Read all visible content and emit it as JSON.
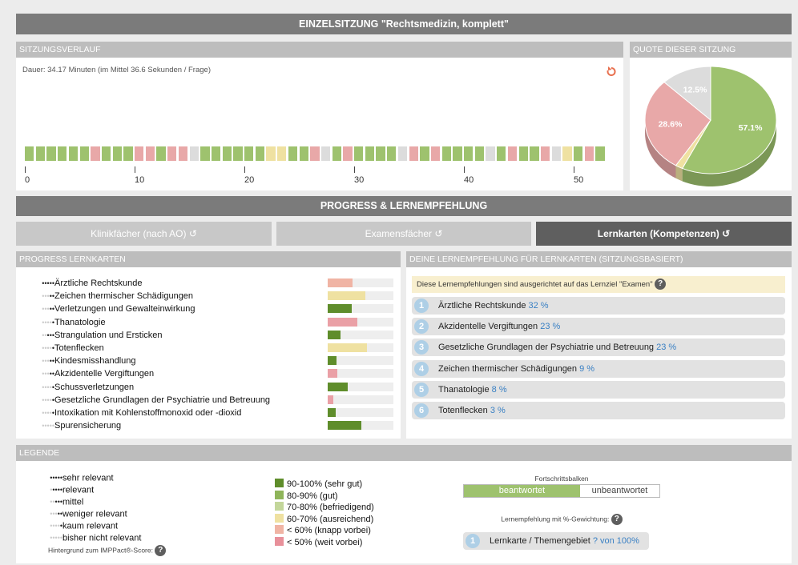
{
  "header": {
    "title": "EINZELSITZUNG \"Rechtsmedizin, komplett\""
  },
  "session": {
    "title": "SITZUNGSVERLAUF",
    "duration": "Dauer: 34.17 Minuten (im Mittel 36.6 Sekunden / Frage)",
    "ticks": [
      "0",
      "10",
      "20",
      "30",
      "40",
      "50"
    ],
    "segments": [
      "g",
      "g",
      "g",
      "g",
      "g",
      "g",
      "r",
      "g",
      "g",
      "g",
      "r",
      "r",
      "g",
      "r",
      "r",
      "x",
      "g",
      "g",
      "g",
      "g",
      "g",
      "g",
      "y",
      "y",
      "g",
      "g",
      "r",
      "x",
      "g",
      "r",
      "g",
      "g",
      "g",
      "g",
      "x",
      "r",
      "g",
      "r",
      "g",
      "g",
      "g",
      "g",
      "x",
      "g",
      "r",
      "g",
      "g",
      "r",
      "x",
      "y",
      "g",
      "r",
      "g"
    ],
    "colors": {
      "g": "#9ec26e",
      "r": "#e8a8a8",
      "y": "#efe1a1",
      "x": "#dcdcdc"
    }
  },
  "quota": {
    "title": "QUOTE DIESER SITZUNG",
    "slices": [
      {
        "label": "57.1%",
        "value": 57.1,
        "color": "#9ec26e"
      },
      {
        "label": "",
        "value": 1.8,
        "color": "#efe1a1"
      },
      {
        "label": "28.6%",
        "value": 28.6,
        "color": "#e8a8a8"
      },
      {
        "label": "12.5%",
        "value": 12.5,
        "color": "#dcdcdc"
      }
    ]
  },
  "progress": {
    "title": "PROGRESS & LERNEMPFEHLUNG"
  },
  "tabs": [
    {
      "label": "Klinikfächer (nach AO) ↺"
    },
    {
      "label": "Examensfächer ↺"
    },
    {
      "label": "Lernkarten (Kompetenzen) ↺"
    }
  ],
  "lernkarten": {
    "title": "PROGRESS LERNKARTEN",
    "items": [
      {
        "label": "Ärztliche Rechtskunde",
        "relevance": 5,
        "progress": 0.38,
        "color": "#f0b4a4"
      },
      {
        "label": "Zeichen thermischer Schädigungen",
        "relevance": 2,
        "progress": 0.57,
        "color": "#efe1a1"
      },
      {
        "label": "Verletzungen und Gewalteinwirkung",
        "relevance": 2,
        "progress": 0.36,
        "color": "#5f8d2b"
      },
      {
        "label": "Thanatologie",
        "relevance": 1,
        "progress": 0.45,
        "color": "#eaa0a6"
      },
      {
        "label": "Strangulation und Ersticken",
        "relevance": 3,
        "progress": 0.2,
        "color": "#5f8d2b"
      },
      {
        "label": "Totenflecken",
        "relevance": 1,
        "progress": 0.6,
        "color": "#efe1a1"
      },
      {
        "label": "Kindesmisshandlung",
        "relevance": 2,
        "progress": 0.14,
        "color": "#5f8d2b"
      },
      {
        "label": "Akzidentelle Vergiftungen",
        "relevance": 2,
        "progress": 0.15,
        "color": "#eaa0a6"
      },
      {
        "label": "Schussverletzungen",
        "relevance": 1,
        "progress": 0.3,
        "color": "#5f8d2b"
      },
      {
        "label": "Gesetzliche Grundlagen der Psychiatrie und Betreuung",
        "relevance": 1,
        "progress": 0.08,
        "color": "#eaa0a6"
      },
      {
        "label": "Intoxikation mit Kohlenstoffmonoxid oder -dioxid",
        "relevance": 1,
        "progress": 0.12,
        "color": "#5f8d2b"
      },
      {
        "label": "Spurensicherung",
        "relevance": 0,
        "progress": 0.51,
        "color": "#5f8d2b"
      }
    ]
  },
  "empfehlung": {
    "title": "DEINE LERNEMPFEHLUNG FÜR LERNKARTEN (SITZUNGSBASIERT)",
    "note": "Diese Lernempfehlungen sind ausgerichtet auf das Lernziel \"Examen\"",
    "items": [
      {
        "num": "1",
        "label": "Ärztliche Rechtskunde",
        "pct": "32 %"
      },
      {
        "num": "2",
        "label": "Akzidentelle Vergiftungen",
        "pct": "23 %"
      },
      {
        "num": "3",
        "label": "Gesetzliche Grundlagen der Psychiatrie und Betreuung",
        "pct": "23 %"
      },
      {
        "num": "4",
        "label": "Zeichen thermischer Schädigungen",
        "pct": "9 %"
      },
      {
        "num": "5",
        "label": "Thanatologie",
        "pct": "8 %"
      },
      {
        "num": "6",
        "label": "Totenflecken",
        "pct": "3 %"
      }
    ]
  },
  "legende": {
    "title": "LEGENDE",
    "relevance": [
      {
        "label": "sehr relevant",
        "level": 5
      },
      {
        "label": "relevant",
        "level": 4
      },
      {
        "label": "mittel",
        "level": 3
      },
      {
        "label": "weniger relevant",
        "level": 2
      },
      {
        "label": "kaum relevant",
        "level": 1
      },
      {
        "label": "bisher nicht relevant",
        "level": 0
      }
    ],
    "hint": "Hintergrund zum IMPPact®-Score:",
    "colors": [
      {
        "label": "90-100% (sehr gut)",
        "color": "#5f8d2b"
      },
      {
        "label": "80-90% (gut)",
        "color": "#8fb55a"
      },
      {
        "label": "70-80% (befriedigend)",
        "color": "#c3d69a"
      },
      {
        "label": "60-70% (ausreichend)",
        "color": "#efe1a1"
      },
      {
        "label": "< 60% (knapp vorbei)",
        "color": "#f0b4a4"
      },
      {
        "label": "< 50% (weit vorbei)",
        "color": "#e8909a"
      }
    ],
    "bar_title": "Fortschrittsbalken",
    "answered": "beantwortet",
    "unanswered": "unbeantwortet",
    "weight_title": "Lernempfehlung mit %-Gewichtung:",
    "example_num": "1",
    "example_label": "Lernkarte / Themengebiet",
    "example_pct": "? von 100%"
  }
}
